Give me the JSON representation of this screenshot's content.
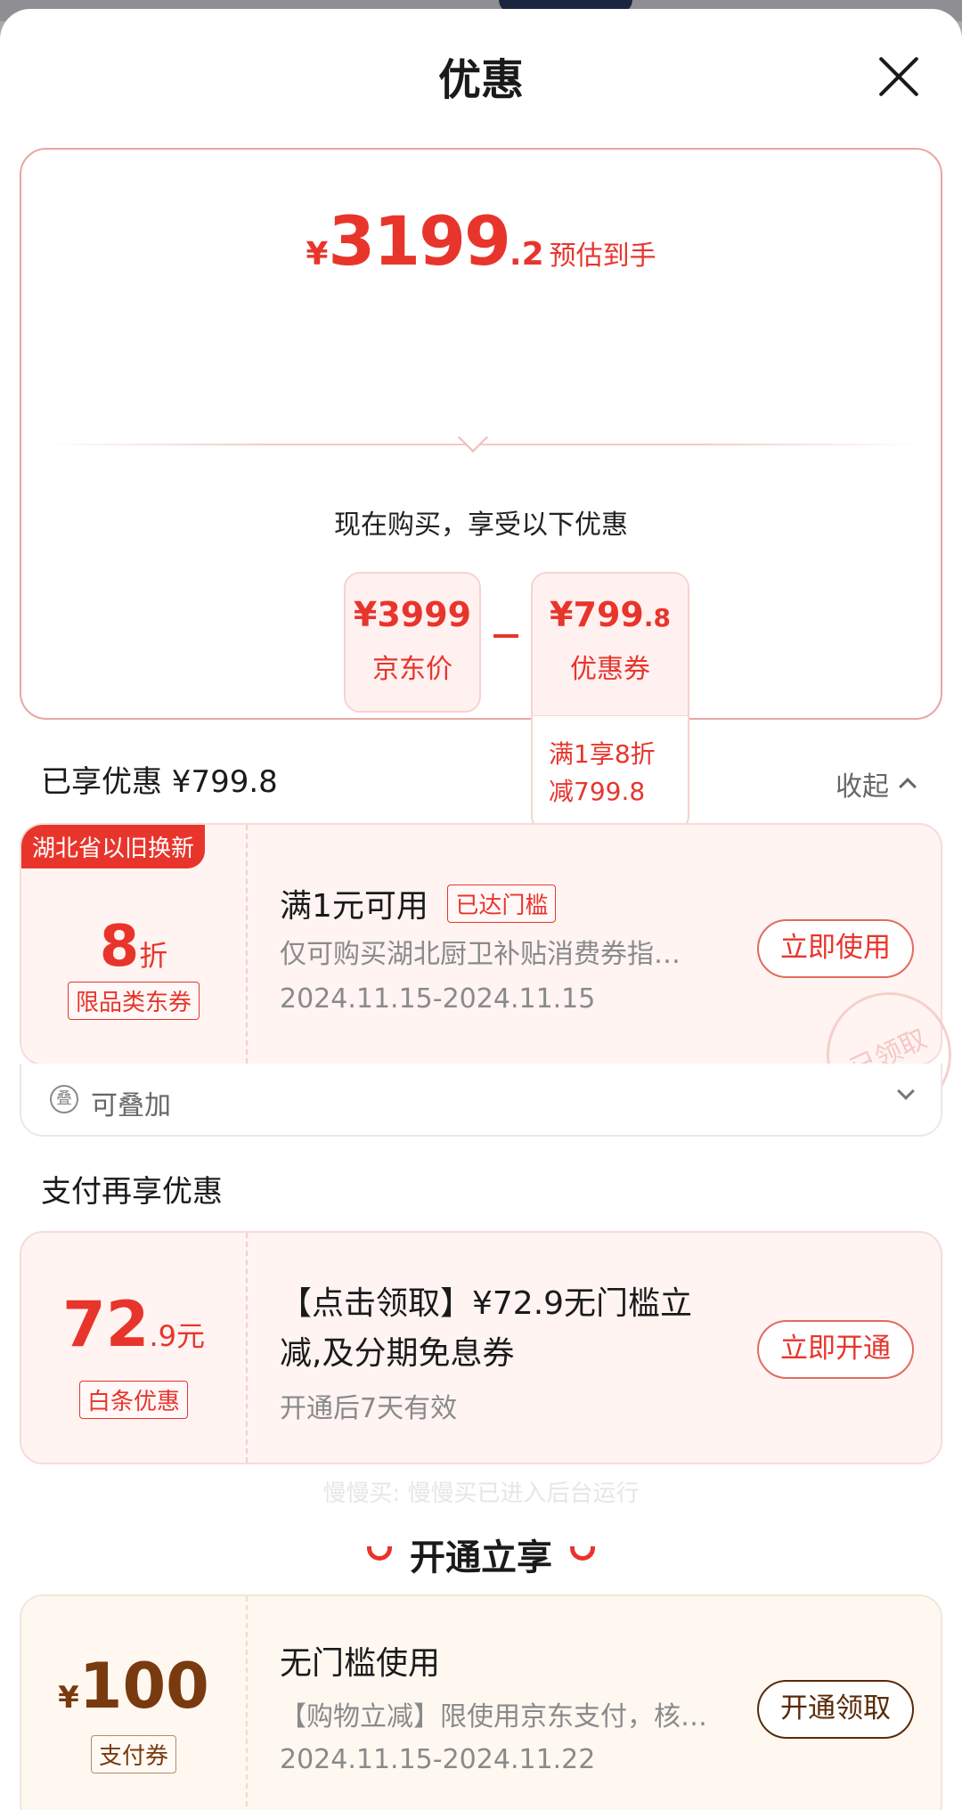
{
  "header": {
    "title": "优惠"
  },
  "summary": {
    "currency": "¥",
    "price_int": "3199",
    "price_dec": ".2",
    "price_label": "预估到手",
    "buy_text": "现在购买，享受以下优惠",
    "jd_price": {
      "yen": "¥",
      "value": "3999",
      "label": "京东价"
    },
    "minus_sign": "-",
    "coupon": {
      "yen": "¥",
      "value": "799",
      "dec": ".8",
      "label": "优惠券",
      "cond1": "满1享8折",
      "cond2": "减799.8"
    }
  },
  "enjoyed": {
    "label": "已享优惠 ¥799.8",
    "collapse": "收起"
  },
  "coupon1": {
    "tag": "湖北省以旧换新",
    "discount": "8",
    "unit": "折",
    "type": "限品类东券",
    "title": "满1元可用",
    "badge": "已达门槛",
    "desc": "仅可购买湖北厨卫补贴消费券指…",
    "date": "2024.11.15-2024.11.15",
    "button": "立即使用",
    "stamp": "已领取",
    "stack_icon": "叠",
    "stackable": "可叠加"
  },
  "payment": {
    "section_title": "支付再享优惠"
  },
  "coupon2": {
    "amount": "72",
    "dec": ".9元",
    "type": "白条优惠",
    "title_line1": "【点击领取】¥72.9无门槛立",
    "title_line2": "减,及分期免息券",
    "validity": "开通后7天有效",
    "button": "立即开通"
  },
  "toast": "慢慢买: 慢慢买已进入后台运行",
  "open_section": {
    "title": "开通立享"
  },
  "coupon3": {
    "yen": "¥",
    "amount": "100",
    "type": "支付券",
    "title": "无门槛使用",
    "desc": "【购物立减】限使用京东支付，核…",
    "date": "2024.11.15-2024.11.22",
    "button": "开通领取"
  },
  "colors": {
    "accent_red": "#e8352c",
    "brown": "#7a3a10",
    "coupon_bg": "#fff4f2",
    "cream_bg": "#fff8f1"
  }
}
